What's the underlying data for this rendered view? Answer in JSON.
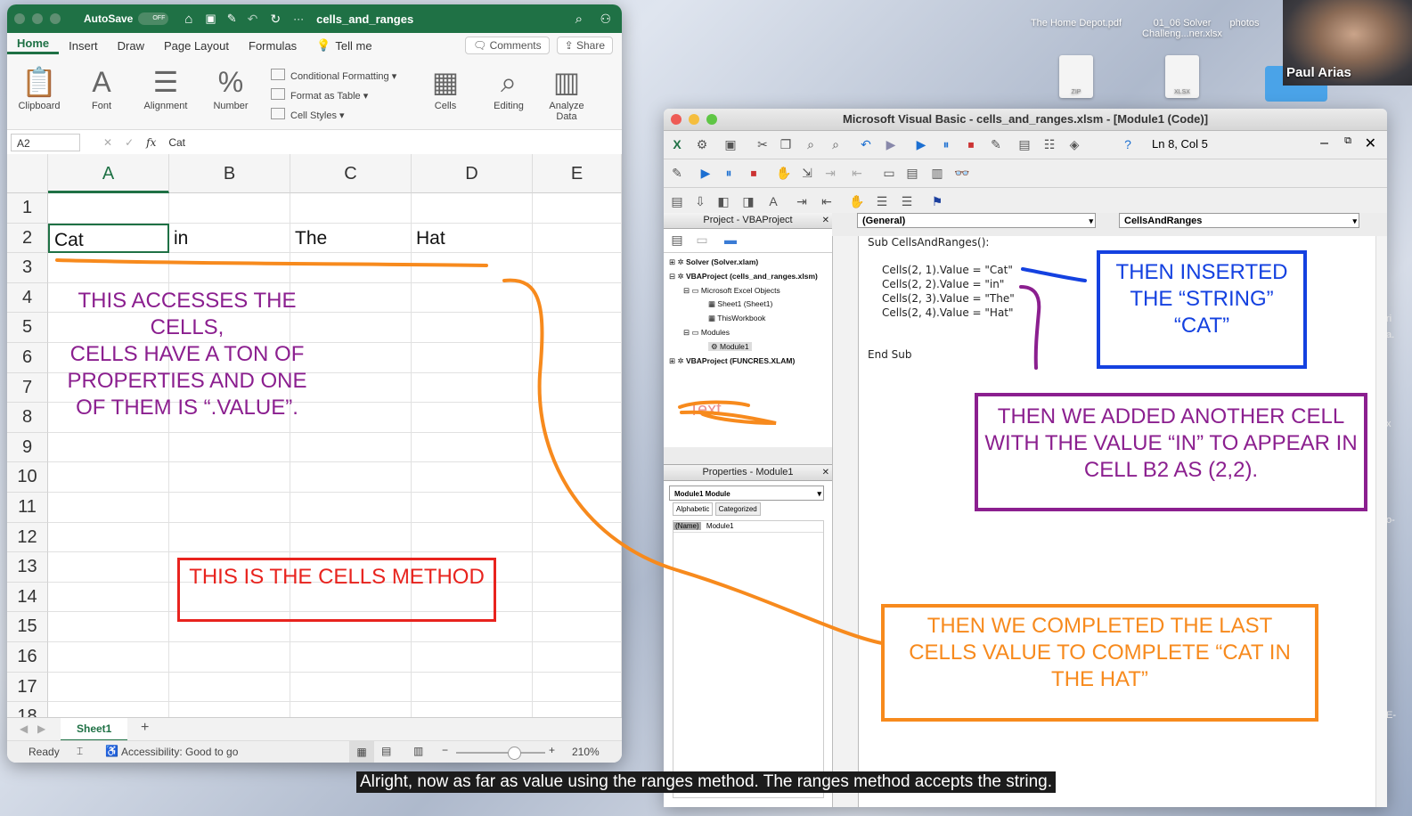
{
  "desktop": {
    "files": [
      {
        "name": "The Home Depot.pdf"
      },
      {
        "name": "01_06 Solver Challeng...ner.xlsx"
      },
      {
        "name": "photos"
      }
    ],
    "zip_tag": "ZIP",
    "xlsx_tag": "XLSX",
    "webcam_name": "Paul Arias",
    "edge_letters": [
      "ri",
      "a.",
      "x",
      "o-",
      "E-"
    ]
  },
  "excel": {
    "titlebar": {
      "autosave": "AutoSave",
      "toggle": "OFF",
      "filename": "cells_and_ranges"
    },
    "tabs": [
      "Home",
      "Insert",
      "Draw",
      "Page Layout",
      "Formulas"
    ],
    "tell_me": "Tell me",
    "comments": "Comments",
    "share": "Share",
    "ribbon": {
      "clipboard": "Clipboard",
      "font": "Font",
      "alignment": "Alignment",
      "number": "Number",
      "conditional_formatting": "Conditional Formatting",
      "format_as_table": "Format as Table",
      "cell_styles": "Cell Styles",
      "cells": "Cells",
      "editing": "Editing",
      "analyze": "Analyze Data"
    },
    "name_box": "A2",
    "fx": "fx",
    "formula": "Cat",
    "columns": [
      "A",
      "B",
      "C",
      "D",
      "E"
    ],
    "rows": [
      "1",
      "2",
      "3",
      "4",
      "5",
      "6",
      "7",
      "8",
      "9",
      "10",
      "11",
      "12",
      "13",
      "14",
      "15",
      "16",
      "17",
      "18"
    ],
    "row2": [
      "Cat",
      "in",
      "The",
      "Hat"
    ],
    "sheet_tab": "Sheet1",
    "status": {
      "ready": "Ready",
      "accessibility": "Accessibility: Good to go",
      "zoom": "210%"
    }
  },
  "vbe": {
    "title": "Microsoft Visual Basic - cells_and_ranges.xlsm - [Module1 (Code)]",
    "position": "Ln 8, Col 5",
    "project_title": "Project - VBAProject",
    "tree": [
      "Solver (Solver.xlam)",
      "VBAProject (cells_and_ranges.xlsm)",
      "Microsoft Excel Objects",
      "Sheet1 (Sheet1)",
      "ThisWorkbook",
      "Modules",
      "Module1",
      "VBAProject (FUNCRES.XLAM)"
    ],
    "scribble_text": "Text",
    "properties_title": "Properties - Module1",
    "prop_combo": "Module1  Module",
    "prop_tabs": [
      "Alphabetic",
      "Categorized"
    ],
    "prop_name_key": "(Name)",
    "prop_name_val": "Module1",
    "combo_general": "(General)",
    "combo_proc": "CellsAndRanges",
    "code": [
      "Sub CellsAndRanges():",
      "Cells(2, 1).Value = \"Cat\"",
      "Cells(2, 2).Value = \"in\"",
      "Cells(2, 3).Value = \"The\"",
      "Cells(2, 4).Value = \"Hat\"",
      "End Sub"
    ]
  },
  "annotations": {
    "accesses": "THIS ACCESSES THE CELLS,\nCELLS HAVE A TON OF PROPERTIES AND ONE OF THEM IS “.VALUE”.",
    "cells_method": "THIS IS THE CELLS METHOD",
    "inserted": "THEN INSERTED THE “STRING” “CAT”",
    "added": "THEN WE ADDED ANOTHER CELL WITH THE VALUE “IN” TO APPEAR IN CELL B2 AS (2,2).",
    "completed": "THEN WE COMPLETED THE LAST CELLS VALUE TO COMPLETE “CAT IN THE HAT”",
    "colors": {
      "purple": "#8b1f8f",
      "red": "#e8231e",
      "blue": "#1441e0",
      "orange": "#f78a1d"
    }
  },
  "caption": "Alright, now as far as value using the ranges method. The ranges method accepts the string."
}
